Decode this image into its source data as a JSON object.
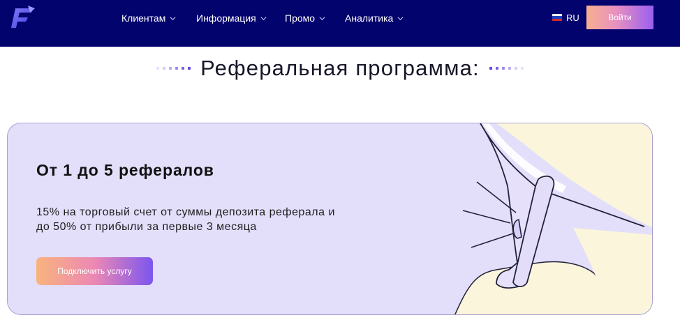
{
  "nav": {
    "items": [
      {
        "label": "Клиентам"
      },
      {
        "label": "Информация"
      },
      {
        "label": "Промо"
      },
      {
        "label": "Аналитика"
      }
    ],
    "language": "RU",
    "login_label": "Войти"
  },
  "section": {
    "title": "Реферальная программа:"
  },
  "card": {
    "title": "От 1 до 5 рефералов",
    "description_line1": "15% на торговый счет от суммы депозита реферала и",
    "description_line2": "до 50% от прибыли за первые 3 месяца",
    "button_label": "Подключить услугу"
  },
  "colors": {
    "header_bg": "#03036e",
    "card_bg": "#e3defa",
    "accent_purple": "#6a4ff0",
    "cream": "#fbf5dc"
  },
  "icons": {
    "logo": "f-arrow-logo-icon",
    "chevron": "chevron-down-icon",
    "flag": "russia-flag-icon",
    "illustration": "megaphone-illustration"
  }
}
